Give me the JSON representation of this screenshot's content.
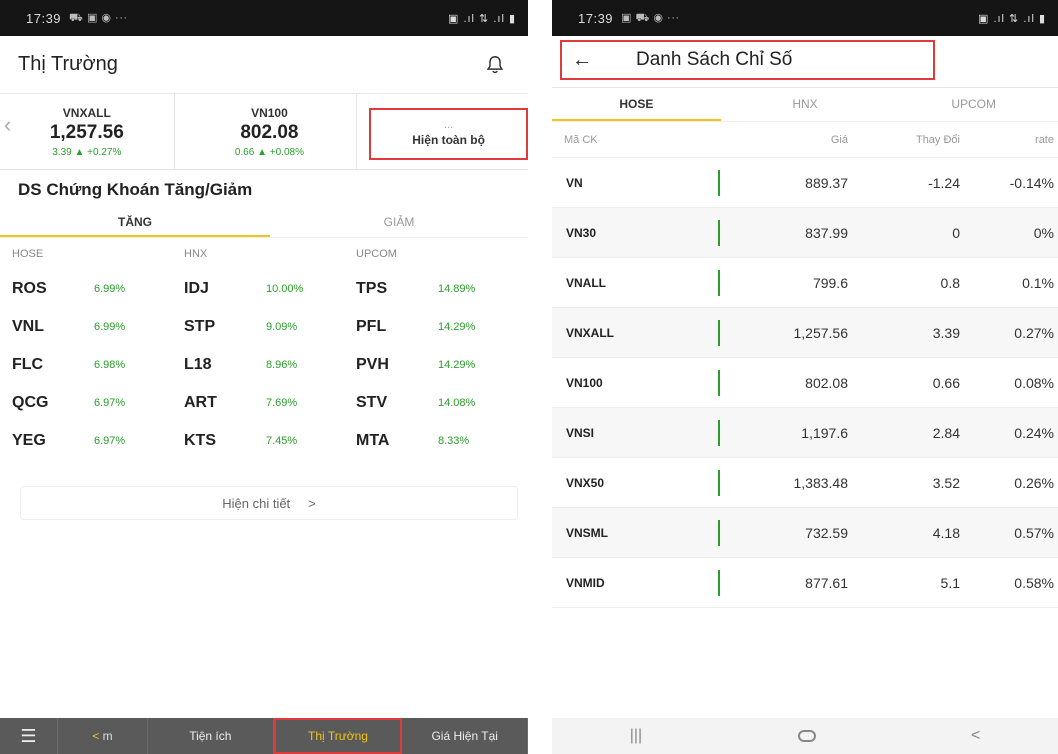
{
  "left": {
    "status": {
      "time": "17:39",
      "icons": "⛟ ▣ ◉ ···",
      "right_icons": "▣ .ıl ⇅ .ıl ▮"
    },
    "header": {
      "title": "Thị Trường"
    },
    "indices": [
      {
        "name": "VNXALL",
        "value": "1,257.56",
        "change": "3.39 ▲ +0.27%"
      },
      {
        "name": "VN100",
        "value": "802.08",
        "change": "0.66 ▲ +0.08%"
      }
    ],
    "show_all": {
      "dots": "...",
      "label": "Hiện toàn bộ"
    },
    "section_title": "DS Chứng Khoán Tăng/Giảm",
    "tabs": {
      "up": "TĂNG",
      "down": "GIẢM"
    },
    "exchanges": [
      "HOSE",
      "HNX",
      "UPCOM"
    ],
    "rows": [
      [
        {
          "sym": "ROS",
          "pct": "6.99%"
        },
        {
          "sym": "IDJ",
          "pct": "10.00%"
        },
        {
          "sym": "TPS",
          "pct": "14.89%"
        }
      ],
      [
        {
          "sym": "VNL",
          "pct": "6.99%"
        },
        {
          "sym": "STP",
          "pct": "9.09%"
        },
        {
          "sym": "PFL",
          "pct": "14.29%"
        }
      ],
      [
        {
          "sym": "FLC",
          "pct": "6.98%"
        },
        {
          "sym": "L18",
          "pct": "8.96%"
        },
        {
          "sym": "PVH",
          "pct": "14.29%"
        }
      ],
      [
        {
          "sym": "QCG",
          "pct": "6.97%"
        },
        {
          "sym": "ART",
          "pct": "7.69%"
        },
        {
          "sym": "STV",
          "pct": "14.08%"
        }
      ],
      [
        {
          "sym": "YEG",
          "pct": "6.97%"
        },
        {
          "sym": "KTS",
          "pct": "7.45%"
        },
        {
          "sym": "MTA",
          "pct": "8.33%"
        }
      ]
    ],
    "detail": {
      "label": "Hiện chi tiết",
      "arrow": ">"
    },
    "bottom_nav": {
      "menu": "☰",
      "back_arrow": "<",
      "back_label": "m",
      "tools": "Tiện ích",
      "market": "Thị Trường",
      "price": "Giá Hiện Tại"
    }
  },
  "right": {
    "status": {
      "time": "17:39",
      "icons": "▣ ⛟ ◉ ···",
      "right_icons": "▣ .ıl ⇅ .ıl ▮"
    },
    "header": {
      "back": "←",
      "title": "Danh Sách Chỉ Số"
    },
    "tabs": [
      "HOSE",
      "HNX",
      "UPCOM"
    ],
    "columns": {
      "code": "Mã CK",
      "price": "Giá",
      "change": "Thay Đổi",
      "rate": "rate"
    },
    "rows": [
      {
        "code": "VN",
        "price": "889.37",
        "change": "-1.24",
        "rate": "-0.14%"
      },
      {
        "code": "VN30",
        "price": "837.99",
        "change": "0",
        "rate": "0%"
      },
      {
        "code": "VNALL",
        "price": "799.6",
        "change": "0.8",
        "rate": "0.1%"
      },
      {
        "code": "VNXALL",
        "price": "1,257.56",
        "change": "3.39",
        "rate": "0.27%"
      },
      {
        "code": "VN100",
        "price": "802.08",
        "change": "0.66",
        "rate": "0.08%"
      },
      {
        "code": "VNSI",
        "price": "1,197.6",
        "change": "2.84",
        "rate": "0.24%"
      },
      {
        "code": "VNX50",
        "price": "1,383.48",
        "change": "3.52",
        "rate": "0.26%"
      },
      {
        "code": "VNSML",
        "price": "732.59",
        "change": "4.18",
        "rate": "0.57%"
      },
      {
        "code": "VNMID",
        "price": "877.61",
        "change": "5.1",
        "rate": "0.58%"
      }
    ],
    "sys_nav": {
      "recents": "|||",
      "back": "<"
    }
  },
  "colors": {
    "accent_yellow": "#f0c419",
    "highlight_red": "#e03a3a",
    "up_green": "#2a9d2a"
  }
}
